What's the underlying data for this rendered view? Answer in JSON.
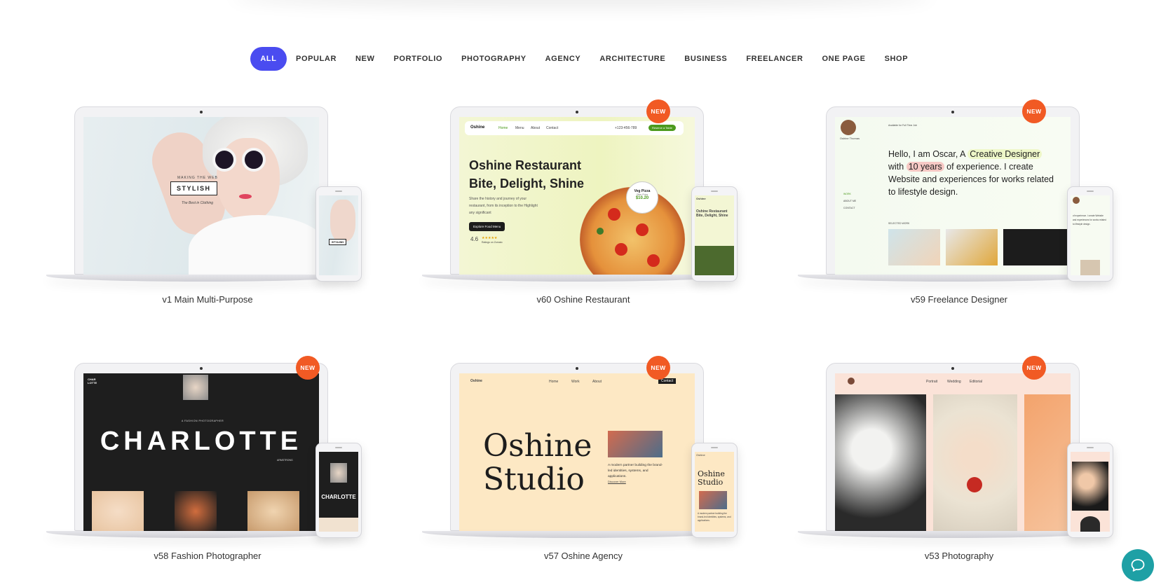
{
  "filters": [
    {
      "label": "ALL",
      "active": true
    },
    {
      "label": "POPULAR"
    },
    {
      "label": "NEW"
    },
    {
      "label": "PORTFOLIO"
    },
    {
      "label": "PHOTOGRAPHY"
    },
    {
      "label": "AGENCY"
    },
    {
      "label": "ARCHITECTURE"
    },
    {
      "label": "BUSINESS"
    },
    {
      "label": "FREELANCER"
    },
    {
      "label": "ONE PAGE"
    },
    {
      "label": "SHOP"
    }
  ],
  "badge_label": "NEW",
  "colors": {
    "accent": "#4a4cf0",
    "badge": "#f15a24",
    "chat": "#1ea0a5"
  },
  "demos": [
    {
      "title": "v1 Main Multi-Purpose",
      "badge": false,
      "screen": {
        "tagline": "MAKING THE WEB",
        "tag": "STYLISH",
        "sub": "The Best in Clothing"
      }
    },
    {
      "title": "v60 Oshine Restaurant",
      "badge": true,
      "screen": {
        "logo": "Oshine",
        "nav": [
          "Home",
          "Menu",
          "About",
          "Contact"
        ],
        "phone": "+123-456-789",
        "cta": "Reserve a Table",
        "headline": "Oshine Restaurant Bite, Delight, Shine",
        "paragraph": "Share the history and journey of your restaurant, from its inception to the Highlight any significant",
        "button": "Explore Food Menu",
        "rating": "4.6",
        "rating_label": "Ratings on Zomato",
        "chip_title": "Veg Pizza",
        "chip_sub": "Offer Price",
        "chip_price": "$10.20"
      }
    },
    {
      "title": "v59 Freelance Designer",
      "badge": true,
      "screen": {
        "name": "Oshine Thomas",
        "availability": "Available for Full Time Job",
        "intro_1": "Hello, I am Oscar, A",
        "highlight_1": "Creative Designer",
        "intro_2": "with",
        "highlight_2": "10 years",
        "intro_3": "of experience. I create Website and experiences for works related to lifestyle design.",
        "menu": [
          "WORK",
          "ABOUT ME",
          "CONTACT"
        ],
        "section": "SELECTED WORK"
      }
    },
    {
      "title": "v58 Fashion Photographer",
      "badge": true,
      "screen": {
        "logo": "CHAR LOTTE",
        "kicker": "A FASHION PHOTOGRAPHER",
        "name": "CHARLOTTE",
        "surname": "ARMSTRONG"
      }
    },
    {
      "title": "v57 Oshine Agency",
      "badge": true,
      "screen": {
        "logo": "Oshine",
        "nav": [
          "Home",
          "Work",
          "About"
        ],
        "cta": "Contact",
        "headline_1": "Oshine",
        "headline_2": "Studio",
        "paragraph": "A modern partner building the brand-led identities, systems, and applications.",
        "link": "Discover More"
      }
    },
    {
      "title": "v53 Photography",
      "badge": true,
      "screen": {
        "nav": [
          "Portrait",
          "Wedding",
          "Editorial"
        ]
      }
    }
  ]
}
